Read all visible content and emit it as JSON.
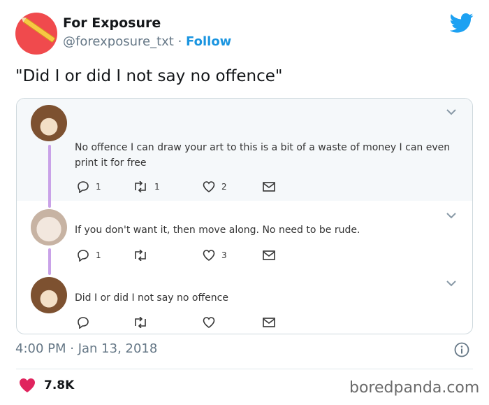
{
  "author": {
    "name": "For Exposure",
    "handle": "@forexposure_txt",
    "separator": "·",
    "follow_label": "Follow"
  },
  "tweet": {
    "text": "\"Did I or did I not say no offence\"",
    "timestamp": "4:00 PM · Jan 13, 2018",
    "likes": "7.8K"
  },
  "thread": [
    {
      "text_line1": "No offence I can draw your art to this is a bit of a waste of money I can even",
      "text_line2": "print it for free",
      "replies": "1",
      "retweets": "1",
      "likes": "2"
    },
    {
      "text_line1": "If you don't want it, then move along. No need to be rude.",
      "replies": "1",
      "retweets": "",
      "likes": "3"
    },
    {
      "text_line1": "Did I or did I not say no offence",
      "replies": "",
      "retweets": "",
      "likes": ""
    }
  ],
  "watermark": "boredpanda.com",
  "colors": {
    "follow": "#1b95e0",
    "twitter_blue": "#1da1f2",
    "heart": "#e0245e",
    "thread_line": "#c9a2e8"
  }
}
